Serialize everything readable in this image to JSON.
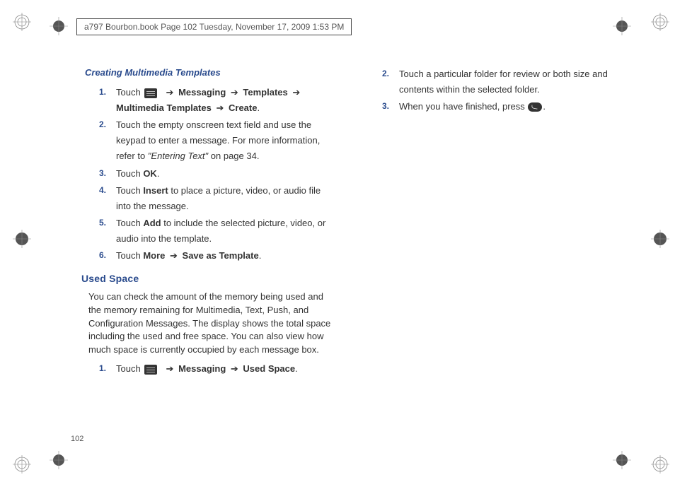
{
  "header": "a797 Bourbon.book  Page 102  Tuesday, November 17, 2009  1:53 PM",
  "page_number": "102",
  "arrow": "➔",
  "left": {
    "heading1": "Creating Multimedia Templates",
    "items1": [
      {
        "n": "1.",
        "pre": "Touch  ",
        "path": [
          "Messaging",
          "Templates",
          "Multimedia Templates",
          "Create"
        ],
        "end": "."
      },
      {
        "n": "2.",
        "text": "Touch the empty onscreen text field and use the keypad to enter a message. For more information, refer to ",
        "ref": "\"Entering Text\"",
        "ref_end": "  on page 34."
      },
      {
        "n": "3.",
        "pre": "Touch ",
        "b": "OK",
        "end": "."
      },
      {
        "n": "4.",
        "pre": "Touch ",
        "b": "Insert",
        "end": " to place a picture, video, or audio file into the message."
      },
      {
        "n": "5.",
        "pre": "Touch ",
        "b": "Add",
        "end": " to include the selected picture, video, or audio into the template."
      },
      {
        "n": "6.",
        "pre": "Touch ",
        "b": "More",
        "arrow": true,
        "b2": "Save as Template",
        "end": "."
      }
    ],
    "heading2": "Used Space",
    "para": "You can check the amount of the memory being used and the memory remaining for Multimedia, Text, Push, and Configuration Messages. The display shows the total space including the used and free space. You can also view how much space is currently occupied by each message box.",
    "items2": [
      {
        "n": "1.",
        "pre": "Touch  ",
        "path": [
          "Messaging",
          "Used Space"
        ],
        "end": "."
      }
    ]
  },
  "right": {
    "items": [
      {
        "n": "2.",
        "text": "Touch a particular folder for review or both size and contents within the selected folder."
      },
      {
        "n": "3.",
        "pre": "When you have finished, press ",
        "icon": "back",
        "end": "."
      }
    ]
  }
}
